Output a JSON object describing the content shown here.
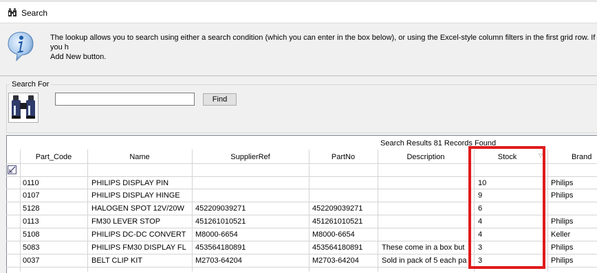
{
  "window": {
    "title": "Search"
  },
  "info": {
    "text": "The lookup allows you to search using either a search condition (which you can enter in the box below), or using the Excel-style column filters in the first grid row.  If you h\nAdd New button."
  },
  "search": {
    "group_label": "Search For",
    "input_value": "",
    "find_label": "Find"
  },
  "results": {
    "caption": "Search Results 81 Records Found",
    "columns": [
      "Part_Code",
      "Name",
      "SupplierRef",
      "PartNo",
      "Description",
      "Stock",
      "Brand"
    ],
    "rows": [
      {
        "part_code": "0110",
        "name": "PHILIPS DISPLAY PIN",
        "supplier_ref": "",
        "part_no": "",
        "description": "",
        "stock": "10",
        "brand": "Philips"
      },
      {
        "part_code": "0107",
        "name": "PHILIPS DISPLAY HINGE",
        "supplier_ref": "",
        "part_no": "",
        "description": "",
        "stock": "9",
        "brand": "Philips"
      },
      {
        "part_code": "5128",
        "name": "HALOGEN SPOT 12V/20W",
        "supplier_ref": "452209039271",
        "part_no": "452209039271",
        "description": "",
        "stock": "6",
        "brand": ""
      },
      {
        "part_code": "0113",
        "name": "FM30 LEVER STOP",
        "supplier_ref": "451261010521",
        "part_no": "451261010521",
        "description": "",
        "stock": "4",
        "brand": "Philips"
      },
      {
        "part_code": "5108",
        "name": "PHILIPS DC-DC CONVERT",
        "supplier_ref": "M8000-6654",
        "part_no": "M8000-6654",
        "description": "",
        "stock": "4",
        "brand": "Keller"
      },
      {
        "part_code": "5083",
        "name": "PHILIPS FM30 DISPLAY FL",
        "supplier_ref": "453564180891",
        "part_no": "453564180891",
        "description": "These come in a box but",
        "stock": "3",
        "brand": "Philips"
      },
      {
        "part_code": "0037",
        "name": "BELT CLIP KIT",
        "supplier_ref": "M2703-64204",
        "part_no": "M2703-64204",
        "description": "Sold in pack of 5 each pa",
        "stock": "3",
        "brand": "Philips"
      }
    ]
  },
  "icons": {
    "title": "binoculars-icon",
    "info": "info-icon",
    "search": "binoculars-icon",
    "filter": "filter-row-icon",
    "sort": "sort-arrow-icon"
  },
  "colors": {
    "highlight": "#e01b1b",
    "info_blue": "#3a7dc9"
  }
}
